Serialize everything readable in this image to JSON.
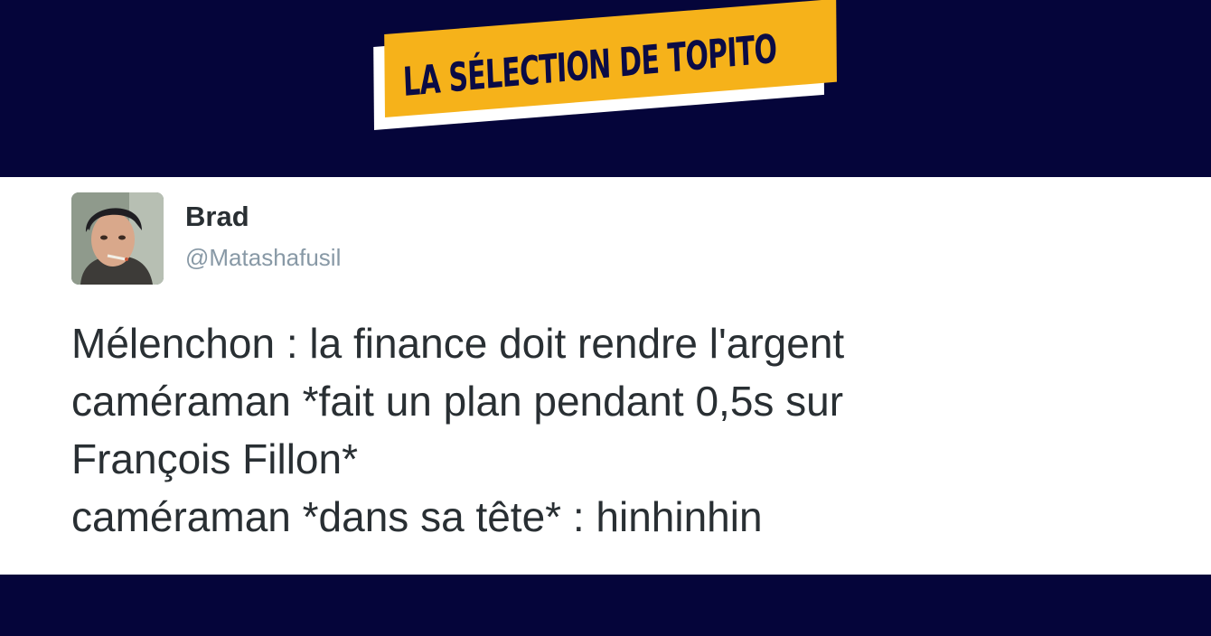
{
  "banner": {
    "label": "LA SÉLECTION DE TOPITO"
  },
  "tweet": {
    "author_name": "Brad",
    "author_handle": "@Matashafusil",
    "lines": [
      "Mélenchon : la finance doit rendre l'argent",
      "caméraman *fait un plan pendant 0,5s sur",
      "François Fillon*",
      "caméraman *dans sa tête* : hinhinhin"
    ]
  },
  "colors": {
    "background": "#05053a",
    "banner_fill": "#f6b21a",
    "banner_text": "#0b0b45",
    "card": "#ffffff",
    "text": "#292f33",
    "handle": "#8899a6"
  }
}
